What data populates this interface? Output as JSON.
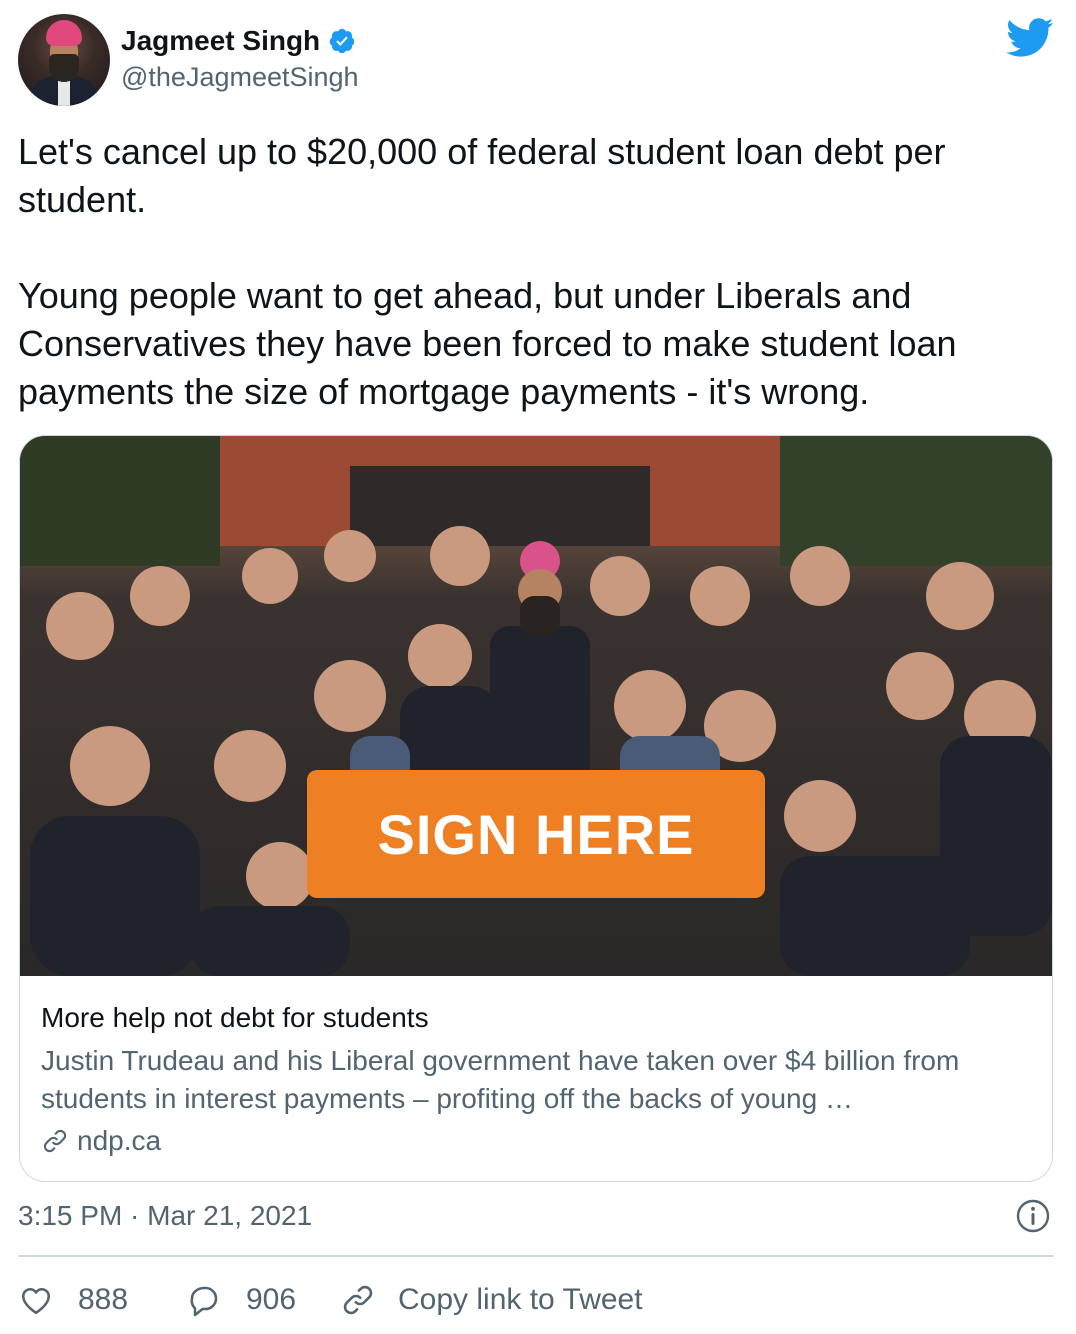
{
  "author": {
    "display_name": "Jagmeet Singh",
    "handle": "@theJagmeetSingh",
    "verified": true,
    "avatar_icon": "profile-photo"
  },
  "tweet": {
    "text": "Let's cancel up to $20,000 of federal student loan debt per student.\n\nYoung people want to get ahead, but under Liberals and Conservatives they have been forced to make student loan payments the size of mortgage payments - it's wrong."
  },
  "card": {
    "image_button_label": "SIGN HERE",
    "title": "More help not debt for students",
    "description": "Justin Trudeau and his Liberal government have taken over $4 billion from students in interest payments – profiting off the backs of young …",
    "domain": "ndp.ca"
  },
  "meta": {
    "timestamp": "3:15 PM · Mar 21, 2021"
  },
  "actions": {
    "likes": "888",
    "replies": "906",
    "copy_link_label": "Copy link to Tweet"
  },
  "colors": {
    "brand_blue": "#1d9bf0",
    "sign_button": "#ee7f22",
    "text_primary": "#0f1419",
    "text_secondary": "#536471",
    "border": "#cfd9de"
  }
}
